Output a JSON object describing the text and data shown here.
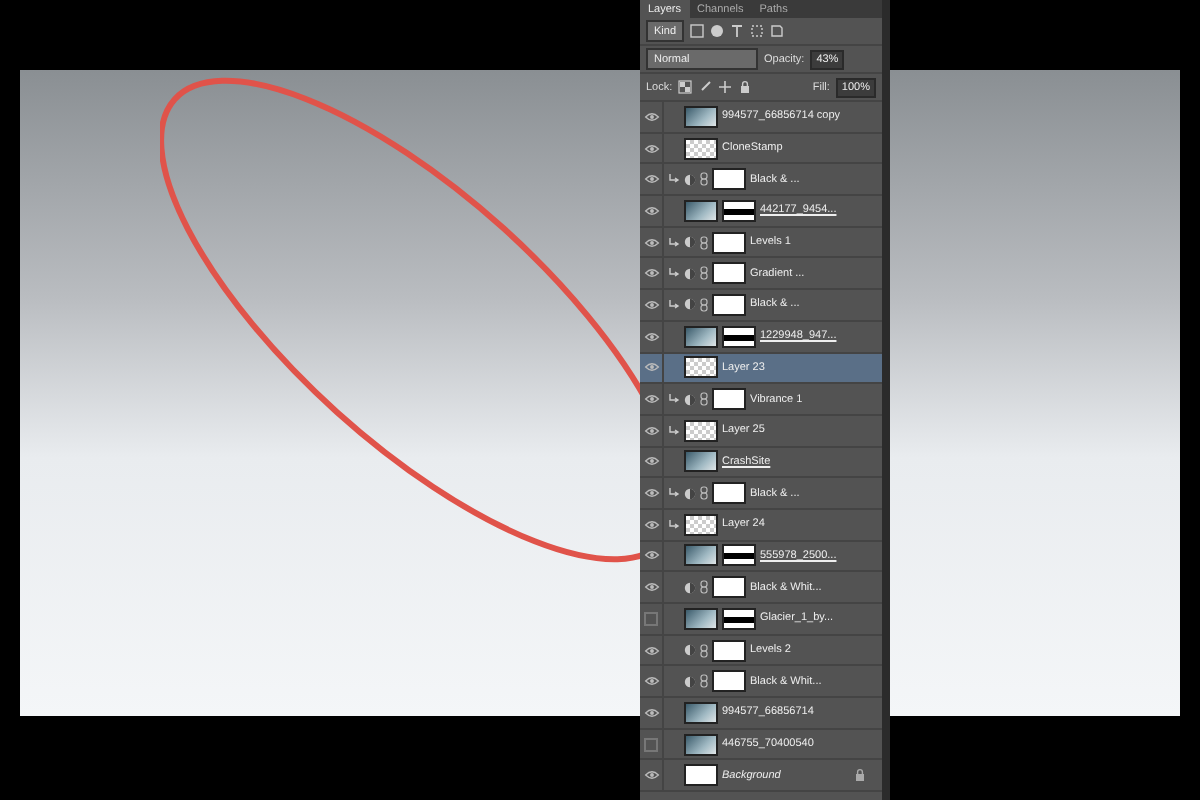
{
  "tabs": [
    {
      "label": "Layers",
      "selected": true
    },
    {
      "label": "Channels",
      "selected": false
    },
    {
      "label": "Paths",
      "selected": false
    }
  ],
  "filter": {
    "label": "Kind"
  },
  "blend_mode": "Normal",
  "opacity_label": "Opacity:",
  "opacity": "43%",
  "lock_label": "Lock:",
  "fill_label": "Fill:",
  "fill": "100%",
  "layers": [
    {
      "name": "994577_66856714 copy",
      "kind": "image",
      "visible": true,
      "clipped": false,
      "mask": false,
      "selected": false,
      "underlined": false,
      "locked": false
    },
    {
      "name": "CloneStamp",
      "kind": "transparent",
      "visible": true,
      "clipped": false,
      "mask": false,
      "selected": false,
      "underlined": false,
      "locked": false
    },
    {
      "name": "Black & ...",
      "kind": "adjustment",
      "visible": true,
      "clipped": true,
      "mask": false,
      "selected": false,
      "underlined": false,
      "locked": false
    },
    {
      "name": "442177_9454...",
      "kind": "image",
      "visible": true,
      "clipped": false,
      "mask": true,
      "selected": false,
      "underlined": true,
      "locked": false
    },
    {
      "name": "Levels 1",
      "kind": "adjustment",
      "visible": true,
      "clipped": true,
      "mask": false,
      "selected": false,
      "underlined": false,
      "locked": false
    },
    {
      "name": "Gradient ...",
      "kind": "adjustment",
      "visible": true,
      "clipped": true,
      "mask": false,
      "selected": false,
      "underlined": false,
      "locked": false
    },
    {
      "name": "Black & ...",
      "kind": "adjustment",
      "visible": true,
      "clipped": true,
      "mask": false,
      "selected": false,
      "underlined": false,
      "locked": false
    },
    {
      "name": "1229948_947...",
      "kind": "image",
      "visible": true,
      "clipped": false,
      "mask": true,
      "selected": false,
      "underlined": true,
      "locked": false
    },
    {
      "name": "Layer 23",
      "kind": "transparent",
      "visible": true,
      "clipped": false,
      "mask": false,
      "selected": true,
      "underlined": false,
      "locked": false
    },
    {
      "name": "Vibrance 1",
      "kind": "adjustment",
      "visible": true,
      "clipped": true,
      "mask": false,
      "selected": false,
      "underlined": false,
      "locked": false
    },
    {
      "name": "Layer 25",
      "kind": "transparent",
      "visible": true,
      "clipped": true,
      "mask": false,
      "selected": false,
      "underlined": false,
      "locked": false
    },
    {
      "name": "CrashSite",
      "kind": "image",
      "visible": true,
      "clipped": false,
      "mask": false,
      "selected": false,
      "underlined": true,
      "locked": false
    },
    {
      "name": "Black & ...",
      "kind": "adjustment",
      "visible": true,
      "clipped": true,
      "mask": false,
      "selected": false,
      "underlined": false,
      "locked": false
    },
    {
      "name": "Layer 24",
      "kind": "transparent",
      "visible": true,
      "clipped": true,
      "mask": false,
      "selected": false,
      "underlined": false,
      "locked": false
    },
    {
      "name": "555978_2500...",
      "kind": "image",
      "visible": true,
      "clipped": false,
      "mask": true,
      "selected": false,
      "underlined": true,
      "locked": false
    },
    {
      "name": "Black & Whit...",
      "kind": "adjustment",
      "visible": true,
      "clipped": false,
      "mask": false,
      "selected": false,
      "underlined": false,
      "locked": false
    },
    {
      "name": "Glacier_1_by...",
      "kind": "image",
      "visible": false,
      "clipped": false,
      "mask": true,
      "selected": false,
      "underlined": false,
      "locked": false
    },
    {
      "name": "Levels 2",
      "kind": "adjustment",
      "visible": true,
      "clipped": false,
      "mask": false,
      "selected": false,
      "underlined": false,
      "locked": false
    },
    {
      "name": "Black & Whit...",
      "kind": "adjustment",
      "visible": true,
      "clipped": false,
      "mask": false,
      "selected": false,
      "underlined": false,
      "locked": false
    },
    {
      "name": "994577_66856714",
      "kind": "image",
      "visible": true,
      "clipped": false,
      "mask": false,
      "selected": false,
      "underlined": false,
      "locked": false
    },
    {
      "name": "446755_70400540",
      "kind": "image",
      "visible": false,
      "clipped": false,
      "mask": false,
      "selected": false,
      "underlined": false,
      "locked": false
    },
    {
      "name": "Background",
      "kind": "background",
      "visible": true,
      "clipped": false,
      "mask": false,
      "selected": false,
      "underlined": false,
      "locked": true
    }
  ]
}
